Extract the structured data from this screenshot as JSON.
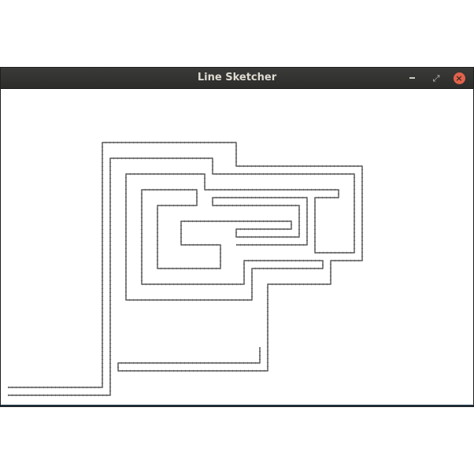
{
  "window": {
    "title": "Line Sketcher",
    "buttons": {
      "minimize": "minimize-icon",
      "maximize": "maximize-icon",
      "close": "close-icon"
    },
    "close_color": "#e2624b",
    "titlebar_color": "#2c2c2a"
  },
  "canvas": {
    "background": "#ffffff",
    "stroke_color": "#333333",
    "tick_color": "#6a6a6a"
  }
}
